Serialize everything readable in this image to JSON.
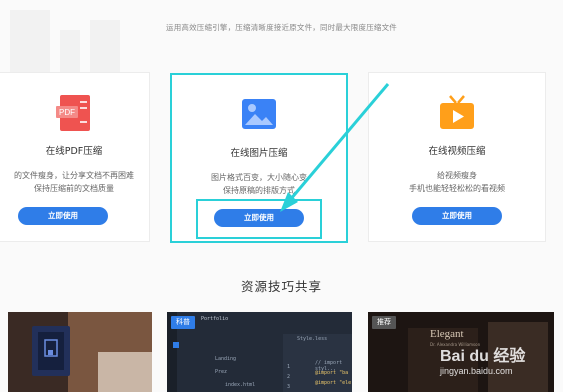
{
  "header": {
    "subtitle": "运用高效压缩引擎，压缩清晰度接近原文件，同时最大限度压缩文件"
  },
  "cards": [
    {
      "title": "在线PDF压缩",
      "desc_line1": "的文件瘦身，让分享文档不再困难",
      "desc_line2": "保持压缩前的文档质量",
      "button": "立即使用",
      "icon": "pdf-icon",
      "icon_label": "PDF",
      "accent": "#ef5350"
    },
    {
      "title": "在线图片压缩",
      "desc_line1": "图片格式百变，大小随心变",
      "desc_line2": "保持原稿的排版方式",
      "button": "立即使用",
      "icon": "image-icon",
      "accent": "#3a82f6"
    },
    {
      "title": "在线视频压缩",
      "desc_line1": "给视频瘦身",
      "desc_line2": "手机也能轻轻松松的看视频",
      "button": "立即使用",
      "icon": "tv-icon",
      "accent": "#ff9f1a"
    }
  ],
  "section": {
    "title": "资源技巧共享"
  },
  "thumbnails": [
    {
      "tag": "",
      "name": "laptop-photo"
    },
    {
      "tag": "科普",
      "name": "code-editor"
    },
    {
      "tag": "推荐",
      "name": "elegant-template"
    }
  ],
  "editor": {
    "folders": [
      "Portfolio",
      "Landing",
      "Prez",
      "index.html"
    ],
    "line_numbers": [
      "1",
      "2",
      "3"
    ],
    "code": [
      "// import styl...",
      "@import \"ba",
      "@import \"ele"
    ],
    "tab": "Style.less"
  },
  "poster": {
    "title": "Elegant",
    "subtitle": "Dr. Alexandra Williamson"
  },
  "watermark": {
    "brand": "Bai du 经验",
    "url": "jingyan.baidu.com"
  },
  "colors": {
    "highlight": "#2ad0d8",
    "button": "#2f7de8"
  }
}
